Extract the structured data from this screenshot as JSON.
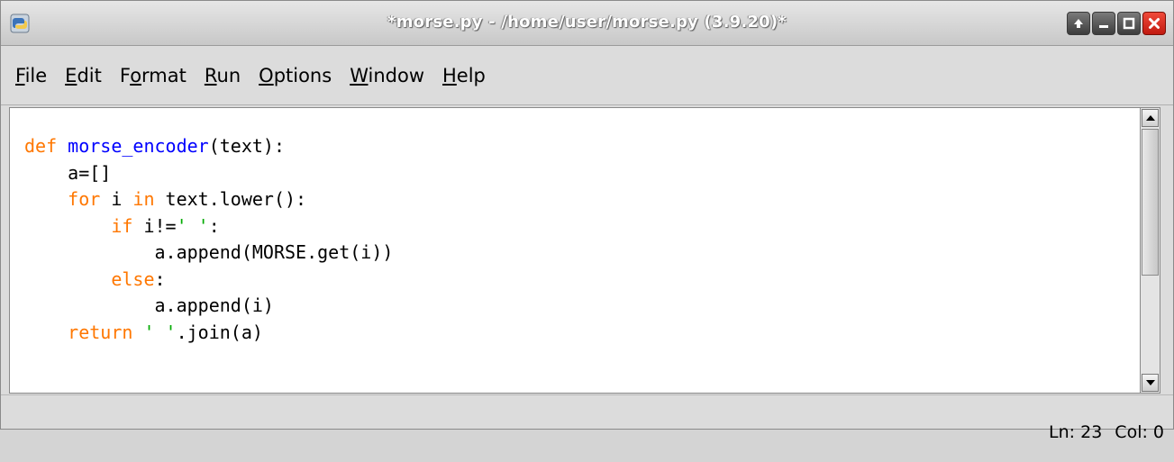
{
  "window": {
    "title": "*morse.py - /home/user/morse.py (3.9.20)*"
  },
  "title_buttons": [
    "up-arrow-icon",
    "minimize-icon",
    "maximize-icon",
    "close-icon"
  ],
  "menu": [
    {
      "pre": "",
      "mnemonic": "F",
      "post": "ile"
    },
    {
      "pre": "",
      "mnemonic": "E",
      "post": "dit"
    },
    {
      "pre": "F",
      "mnemonic": "o",
      "post": "rmat"
    },
    {
      "pre": "",
      "mnemonic": "R",
      "post": "un"
    },
    {
      "pre": "",
      "mnemonic": "O",
      "post": "ptions"
    },
    {
      "pre": "",
      "mnemonic": "W",
      "post": "indow"
    },
    {
      "pre": "",
      "mnemonic": "H",
      "post": "elp"
    }
  ],
  "code": [
    [
      {
        "t": "kw",
        "v": "def "
      },
      {
        "t": "fn",
        "v": "morse_encoder"
      },
      {
        "t": "plain",
        "v": "(text):"
      }
    ],
    [
      {
        "t": "plain",
        "v": "    a=[]"
      }
    ],
    [
      {
        "t": "plain",
        "v": "    "
      },
      {
        "t": "kw",
        "v": "for"
      },
      {
        "t": "plain",
        "v": " i "
      },
      {
        "t": "kw",
        "v": "in"
      },
      {
        "t": "plain",
        "v": " text.lower():"
      }
    ],
    [
      {
        "t": "plain",
        "v": "        "
      },
      {
        "t": "kw",
        "v": "if"
      },
      {
        "t": "plain",
        "v": " i!="
      },
      {
        "t": "str",
        "v": "' '"
      },
      {
        "t": "plain",
        "v": ":"
      }
    ],
    [
      {
        "t": "plain",
        "v": "            a.append(MORSE.get(i))"
      }
    ],
    [
      {
        "t": "plain",
        "v": "        "
      },
      {
        "t": "kw",
        "v": "else"
      },
      {
        "t": "plain",
        "v": ":"
      }
    ],
    [
      {
        "t": "plain",
        "v": "            a.append(i)"
      }
    ],
    [
      {
        "t": "plain",
        "v": "    "
      },
      {
        "t": "kw",
        "v": "return"
      },
      {
        "t": "plain",
        "v": " "
      },
      {
        "t": "str",
        "v": "' '"
      },
      {
        "t": "plain",
        "v": ".join(a)"
      }
    ]
  ],
  "syntax_colors": {
    "keyword": "#ff7700",
    "definition": "#0000ff",
    "string": "#00aa00",
    "text": "#000000"
  },
  "status": {
    "line": "Ln: 23",
    "col": "Col: 0"
  }
}
